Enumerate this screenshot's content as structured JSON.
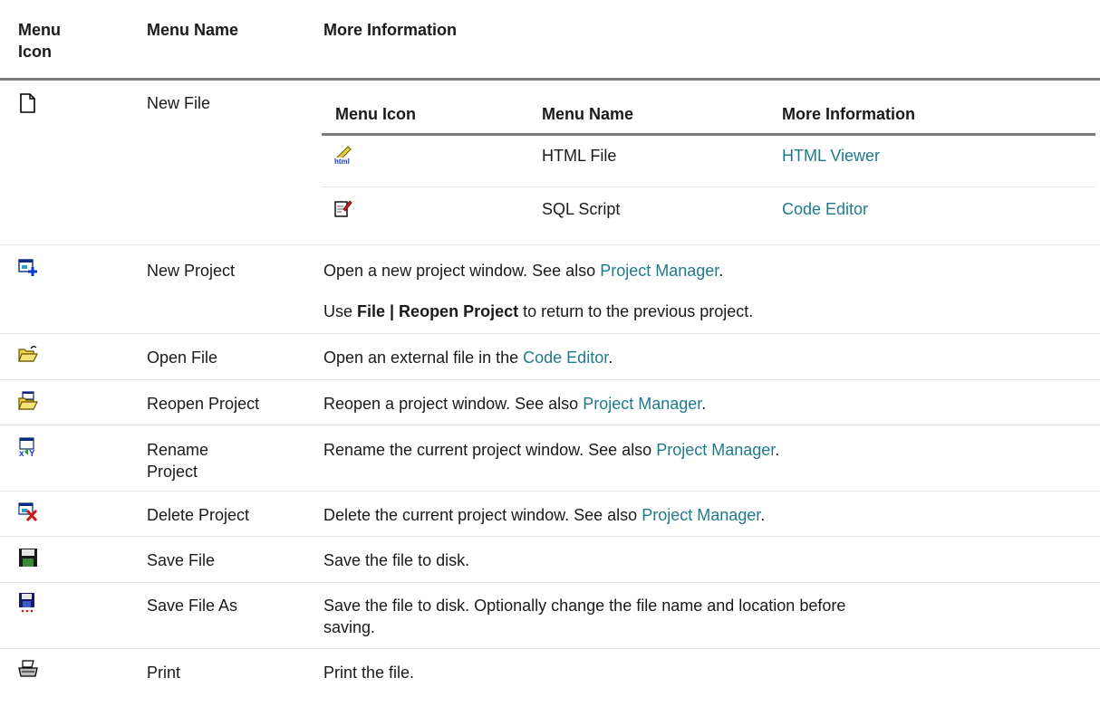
{
  "headers": {
    "icon": "Menu Icon",
    "name": "Menu Name",
    "info": "More Information"
  },
  "rows": [
    {
      "name": "New File",
      "icon": "new-file-icon"
    },
    {
      "name": "New Project",
      "icon": "new-project-icon",
      "info": {
        "p1_text": "Open a new project window. See also ",
        "p1_link": "Project Manager",
        "p1_end": ".",
        "p2_pre": "Use ",
        "p2_bold": "File | Reopen Project",
        "p2_post": " to return to the previous project."
      }
    },
    {
      "name": "Open File",
      "icon": "open-file-icon",
      "info": {
        "text": "Open an external file in the ",
        "link": "Code Editor",
        "end": "."
      }
    },
    {
      "name": "Reopen Project",
      "icon": "reopen-project-icon",
      "info": {
        "text": "Reopen a project window. See also ",
        "link": "Project Manager",
        "end": "."
      }
    },
    {
      "name_l1": "Rename",
      "name_l2": "Project",
      "icon": "rename-project-icon",
      "info": {
        "text": "Rename the current project window. See also ",
        "link": "Project Manager",
        "end": "."
      }
    },
    {
      "name": "Delete Project",
      "icon": "delete-project-icon",
      "info": {
        "text": "Delete the current project window. See also ",
        "link": "Project Manager",
        "end": "."
      }
    },
    {
      "name": "Save File",
      "icon": "save-file-icon",
      "info": {
        "text": "Save the file to disk."
      }
    },
    {
      "name": "Save File As",
      "icon": "save-file-as-icon",
      "info": {
        "l1": "Save the file to disk. Optionally change the file name and location before",
        "l2": "saving."
      }
    },
    {
      "name": "Print",
      "icon": "print-icon",
      "info": {
        "text": "Print the file."
      }
    }
  ],
  "subtable": {
    "headers": {
      "icon": "Menu Icon",
      "name": "Menu Name",
      "info": "More Information"
    },
    "rows": [
      {
        "name": "HTML File",
        "link": "HTML Viewer",
        "icon": "html-file-icon"
      },
      {
        "name": "SQL Script",
        "link": "Code Editor",
        "icon": "sql-script-icon"
      }
    ]
  },
  "colors": {
    "link": "#1f7a8c",
    "rule": "#7a7a7a",
    "divider": "#e3e3e3"
  }
}
